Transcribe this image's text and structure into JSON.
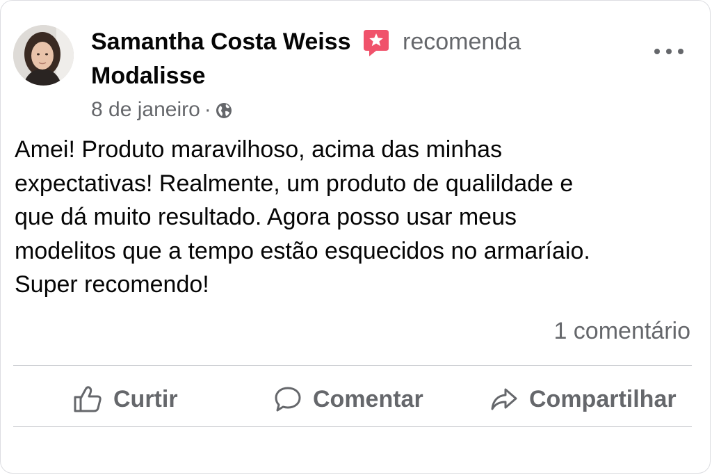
{
  "post": {
    "author": "Samantha Costa Weiss",
    "action_text": "recomenda",
    "page_name": "Modalisse",
    "date": "8 de janeiro",
    "separator": "·",
    "privacy_icon": "globe-icon",
    "recommend_icon": "recommend-star-icon",
    "accent_color": "#f0526b",
    "text_lines": [
      "Amei! Produto maravilhoso, acima das minhas",
      "expectativas! Realmente, um produto de qualildade e",
      "que dá muito resultado. Agora posso usar meus",
      "modelitos que a tempo estão esquecidos no armaríaio.",
      "Super recomendo!"
    ],
    "comment_count": "1 comentário"
  },
  "actions": {
    "like": {
      "label": "Curtir",
      "icon": "thumbs-up-icon"
    },
    "comment": {
      "label": "Comentar",
      "icon": "comment-bubble-icon"
    },
    "share": {
      "label": "Compartilhar",
      "icon": "share-arrow-icon"
    }
  }
}
